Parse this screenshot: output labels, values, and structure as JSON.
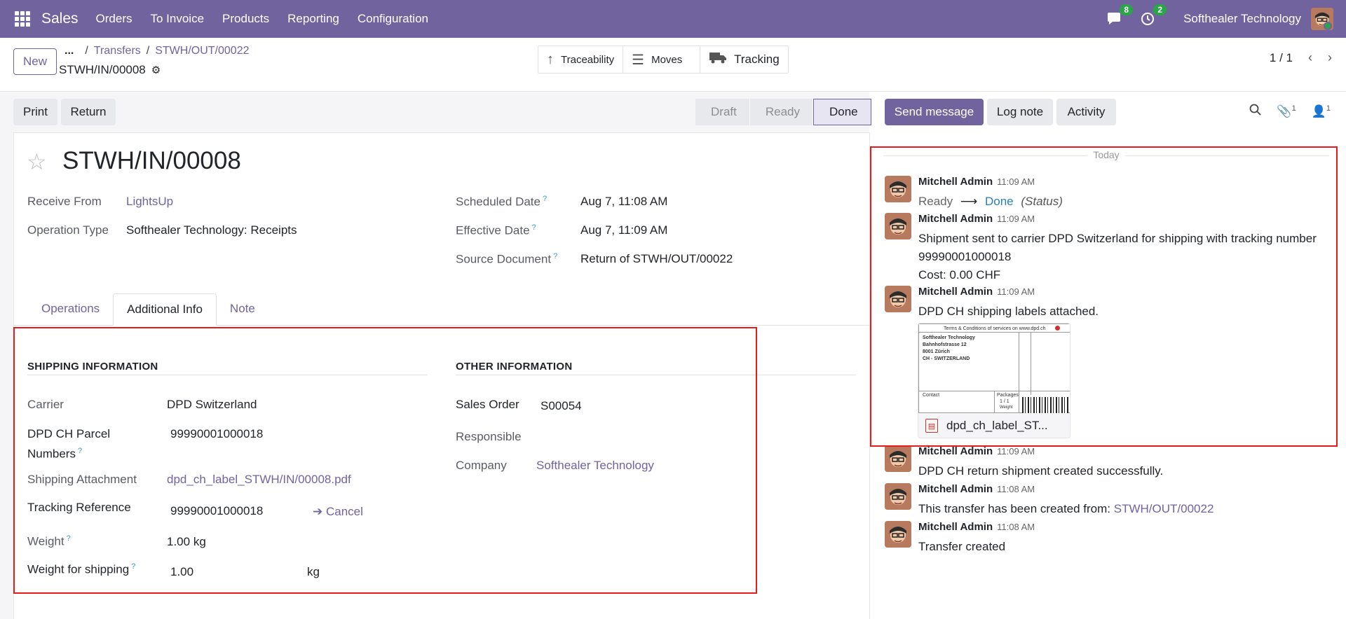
{
  "navbar": {
    "app_name": "Sales",
    "menu": [
      "Orders",
      "To Invoice",
      "Products",
      "Reporting",
      "Configuration"
    ],
    "messages_count": "8",
    "activities_count": "2",
    "company": "Softhealer Technology"
  },
  "control_panel": {
    "new_label": "New",
    "breadcrumb": {
      "dots": "...",
      "parent": "Transfers",
      "current": "STWH/OUT/00022"
    },
    "record_name": "STWH/IN/00008",
    "smart_buttons": {
      "traceability": "Traceability",
      "moves": "Moves",
      "tracking": "Tracking"
    },
    "pager": "1 / 1"
  },
  "form": {
    "print_label": "Print",
    "return_label": "Return",
    "status_steps": [
      "Draft",
      "Ready",
      "Done"
    ],
    "active_status": "Done",
    "title": "STWH/IN/00008",
    "fields": {
      "receive_from_label": "Receive From",
      "receive_from_value": "LightsUp",
      "operation_type_label": "Operation Type",
      "operation_type_value": "Softhealer Technology: Receipts",
      "scheduled_date_label": "Scheduled Date",
      "scheduled_date_value": "Aug 7, 11:08 AM",
      "effective_date_label": "Effective Date",
      "effective_date_value": "Aug 7, 11:09 AM",
      "source_document_label": "Source Document",
      "source_document_value": "Return of STWH/OUT/00022"
    },
    "tabs": [
      "Operations",
      "Additional Info",
      "Note"
    ],
    "active_tab": "Additional Info",
    "shipping": {
      "title": "SHIPPING INFORMATION",
      "carrier_label": "Carrier",
      "carrier_value": "DPD Switzerland",
      "parcel_label_1": "DPD CH Parcel",
      "parcel_label_2": "Numbers",
      "parcel_value": "99990001000018",
      "attachment_label": "Shipping Attachment",
      "attachment_value": "dpd_ch_label_STWH/IN/00008.pdf",
      "tracking_label": "Tracking Reference",
      "tracking_value": "99990001000018",
      "cancel_label": "Cancel",
      "weight_label": "Weight",
      "weight_value": "1.00",
      "weight_unit": "kg",
      "weight_shipping_label": "Weight for shipping",
      "weight_shipping_value": "1.00",
      "weight_shipping_unit": "kg"
    },
    "other": {
      "title": "OTHER INFORMATION",
      "sales_order_label": "Sales Order",
      "sales_order_value": "S00054",
      "responsible_label": "Responsible",
      "company_label": "Company",
      "company_value": "Softhealer Technology"
    }
  },
  "chatter": {
    "send_message": "Send message",
    "log_note": "Log note",
    "activity": "Activity",
    "attachments_count": "1",
    "followers_count": "1",
    "today": "Today",
    "messages": [
      {
        "author": "Mitchell Admin",
        "time": "11:09 AM",
        "from": "Ready",
        "to": "Done",
        "field": "(Status)"
      },
      {
        "author": "Mitchell Admin",
        "time": "11:09 AM",
        "line1": "Shipment sent to carrier DPD Switzerland for shipping with tracking number",
        "line2": "99990001000018",
        "line3": "Cost: 0.00 CHF"
      },
      {
        "author": "Mitchell Admin",
        "time": "11:09 AM",
        "text": "DPD CH shipping labels attached."
      },
      {
        "author": "Mitchell Admin",
        "time": "11:09 AM",
        "text": "DPD CH return shipment created successfully."
      },
      {
        "author": "Mitchell Admin",
        "time": "11:08 AM",
        "text": "This transfer has been created from:",
        "link": "STWH/OUT/00022"
      },
      {
        "author": "Mitchell Admin",
        "time": "11:08 AM",
        "text": "Transfer created"
      }
    ],
    "attachment": {
      "name": "dpd_ch_label_ST...",
      "preview_header": "Terms & Conditions of services on www.dpd.ch",
      "preview_lines": [
        "Softhealer Technology",
        "Bahnhofstrasse 12",
        "8001 Zürich",
        "CH - SWITZERLAND"
      ],
      "preview_contact": "Contact",
      "preview_packages": "Packages",
      "preview_count": "1 / 1",
      "preview_weight": "Weight"
    }
  }
}
